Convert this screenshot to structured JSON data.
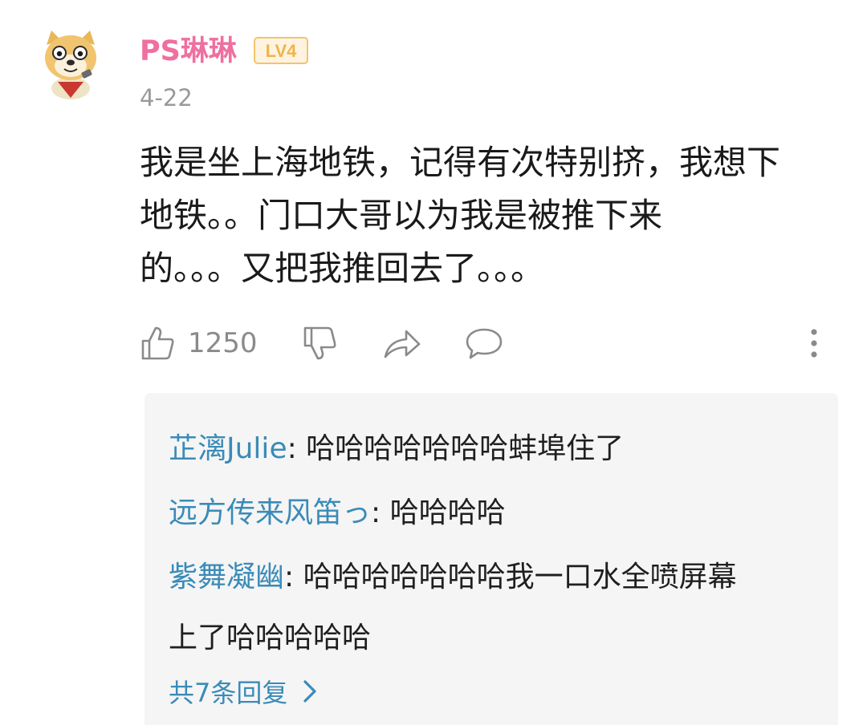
{
  "comment": {
    "username": "PS琳琳",
    "level": "LV4",
    "date": "4-22",
    "text_lines": [
      "我是坐上海地铁，记得有次特别挤，我想下",
      "地铁。。门口大哥以为我是被推下来",
      "的。。。又把我推回去了。。。"
    ],
    "like_count": "1250"
  },
  "replies": {
    "items": [
      {
        "author": "芷漓Julie",
        "separator": ": ",
        "text": "哈哈哈哈哈哈哈蚌埠住了"
      },
      {
        "author": "远方传来风笛っ",
        "separator": ": ",
        "text": "哈哈哈哈"
      },
      {
        "author": "紫舞凝幽",
        "separator": ": ",
        "text": "哈哈哈哈哈哈哈我一口水全喷屏幕上了哈哈哈哈哈"
      }
    ],
    "more_label": "共7条回复"
  },
  "icons": {
    "like": "thumbs-up-icon",
    "dislike": "thumbs-down-icon",
    "share": "share-icon",
    "reply": "chat-bubble-icon",
    "more": "more-vertical-icon",
    "chevron": "chevron-right-icon"
  },
  "colors": {
    "username": "#ef6fa0",
    "level_badge": "#f3c46a",
    "reply_author": "#3a8bb8",
    "replies_bg": "#f5f5f5",
    "muted": "#8a8a8a"
  }
}
